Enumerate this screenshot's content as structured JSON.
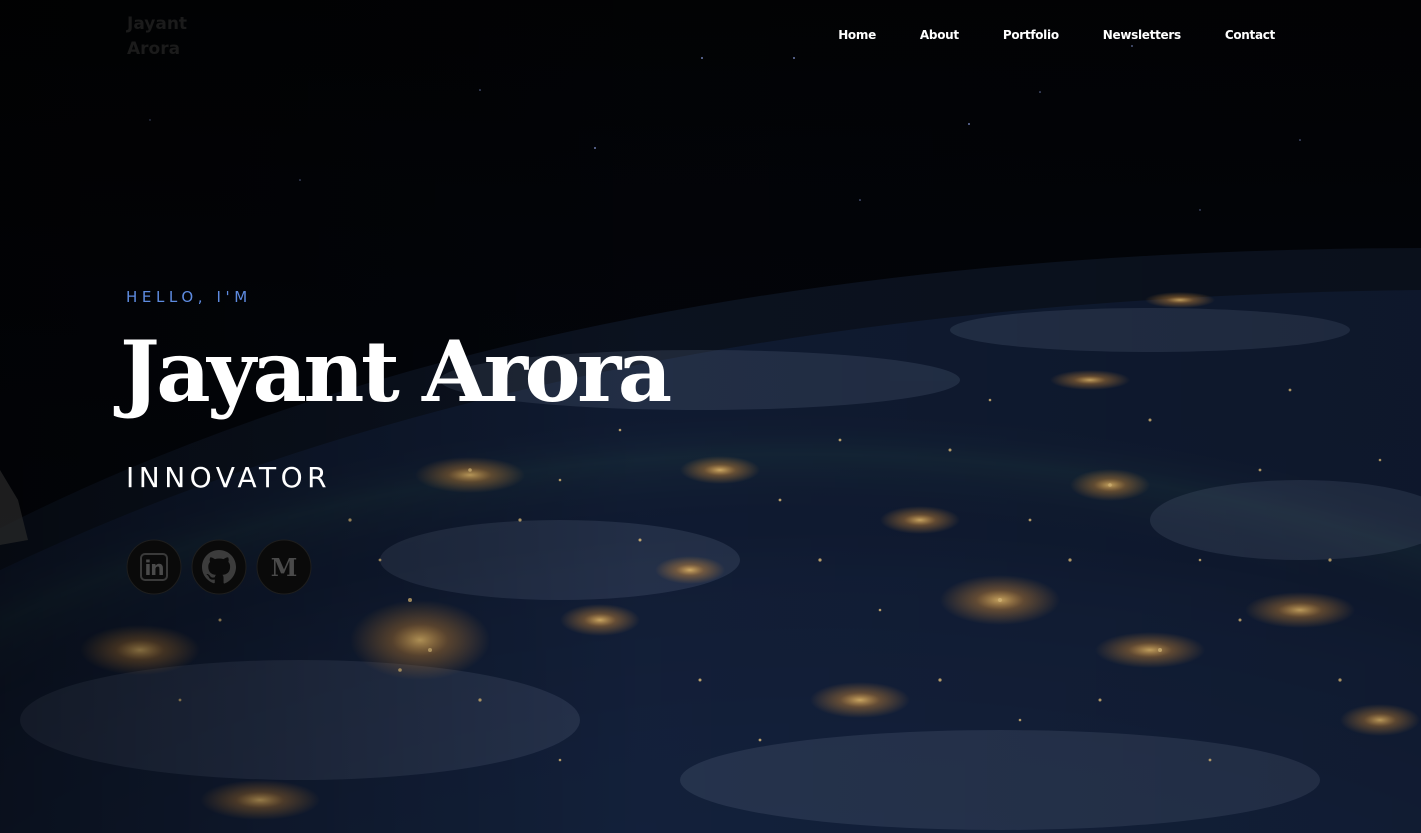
{
  "logo": {
    "line1": "Jayant",
    "line2": "Arora"
  },
  "nav": {
    "items": [
      {
        "label": "Home"
      },
      {
        "label": "About"
      },
      {
        "label": "Portfolio"
      },
      {
        "label": "Newsletters"
      },
      {
        "label": "Contact"
      }
    ]
  },
  "hero": {
    "greeting": "HELLO, I'M",
    "name": "Jayant Arora",
    "role": "INNOVATOR"
  },
  "socials": [
    {
      "icon": "linkedin-icon",
      "glyph": "in"
    },
    {
      "icon": "github-icon"
    },
    {
      "icon": "medium-icon",
      "glyph": "M"
    }
  ],
  "colors": {
    "accent": "#5e8be0",
    "text": "#ffffff",
    "logo": "#1b1b1b"
  }
}
